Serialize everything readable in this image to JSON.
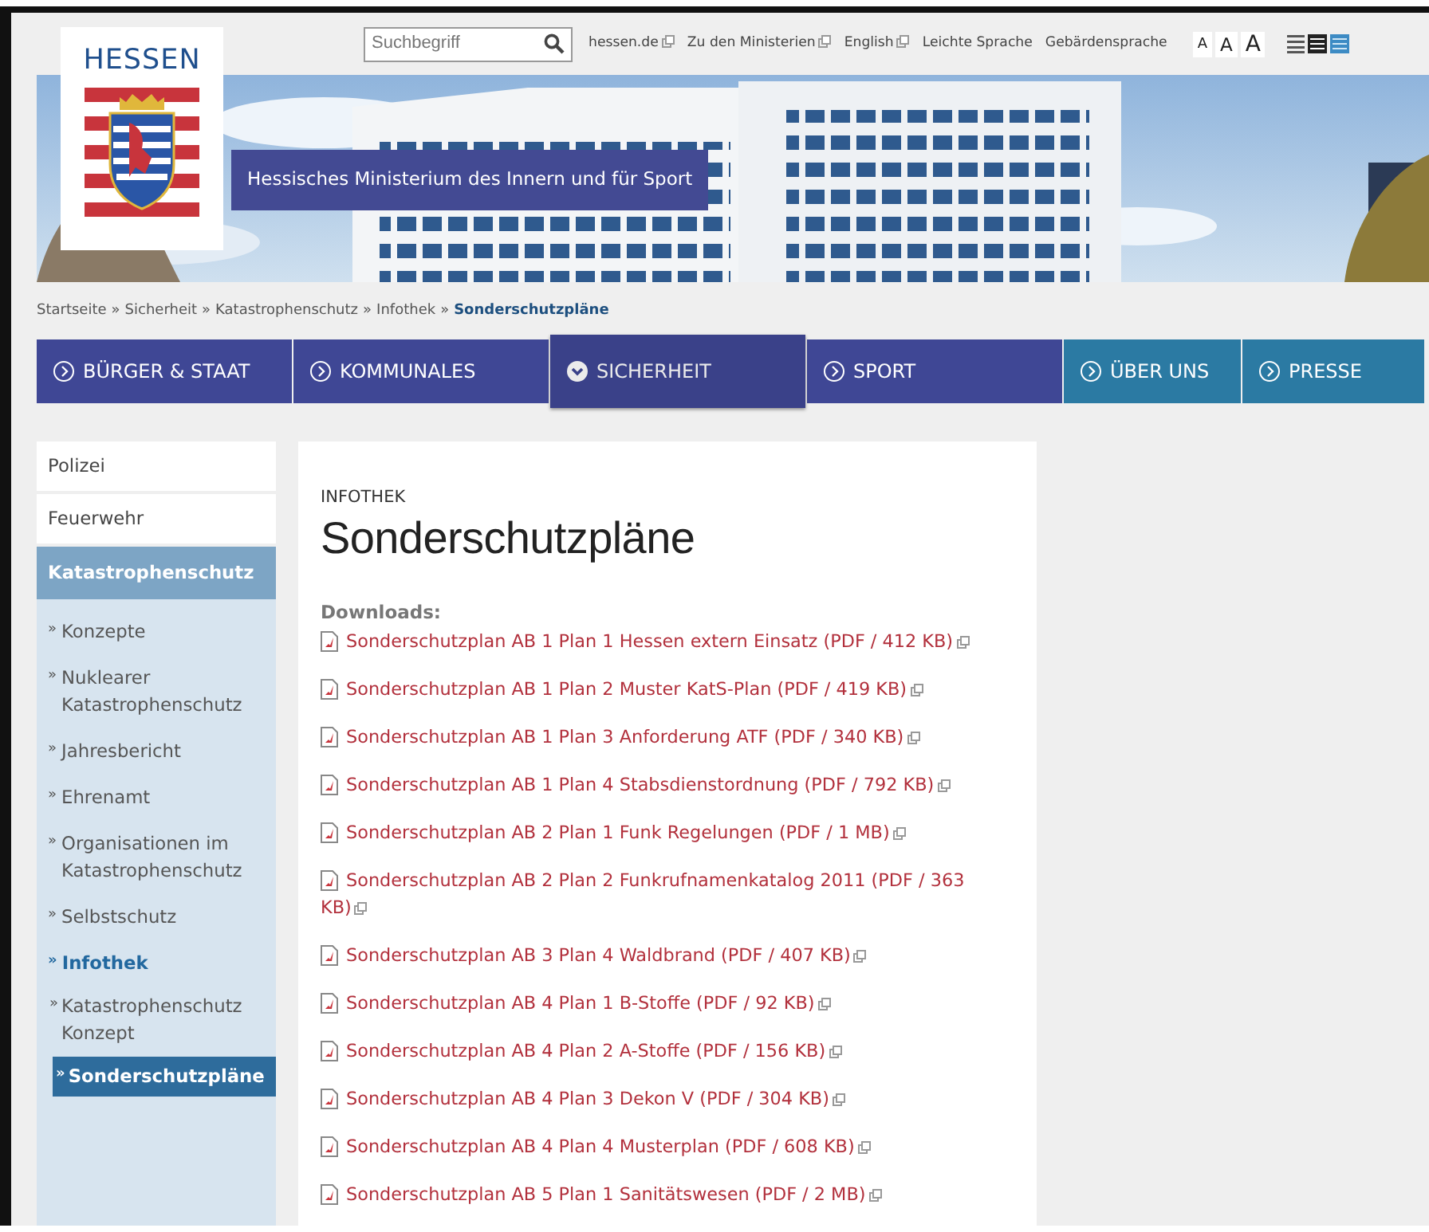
{
  "logo": {
    "text": "HESSEN"
  },
  "search": {
    "placeholder": "Suchbegriff"
  },
  "service_links": [
    {
      "label": "hessen.de",
      "external": true
    },
    {
      "label": "Zu den Ministerien",
      "external": true
    },
    {
      "label": "English",
      "external": true
    },
    {
      "label": "Leichte Sprache",
      "external": false
    },
    {
      "label": "Gebärdensprache",
      "external": false
    }
  ],
  "font_sizes": [
    "A",
    "A",
    "A"
  ],
  "ministry": "Hessisches Ministerium des Innern und für Sport",
  "breadcrumb": {
    "separators": [
      "»",
      "»",
      "»",
      "»"
    ],
    "items": [
      {
        "label": "Startseite",
        "current": false
      },
      {
        "label": "Sicherheit",
        "current": false
      },
      {
        "label": "Katastrophenschutz",
        "current": false
      },
      {
        "label": "Infothek",
        "current": false
      },
      {
        "label": "Sonderschutzpläne",
        "current": true
      }
    ]
  },
  "nav": [
    {
      "label": "BÜRGER & STAAT",
      "selected": false,
      "color": "#3f4795"
    },
    {
      "label": "KOMMUNALES",
      "selected": false,
      "color": "#3f4795"
    },
    {
      "label": "SICHERHEIT",
      "selected": true,
      "color": "#3f4795"
    },
    {
      "label": "SPORT",
      "selected": false,
      "color": "#3f4795"
    },
    {
      "label": "ÜBER UNS",
      "selected": false,
      "color": "#2b7aa3"
    },
    {
      "label": "PRESSE",
      "selected": false,
      "color": "#2b7aa3"
    }
  ],
  "sidebar": [
    {
      "kind": "top",
      "label": "Polizei"
    },
    {
      "kind": "top",
      "label": "Feuerwehr"
    },
    {
      "kind": "section",
      "label": "Katastrophenschutz",
      "children": [
        {
          "bullet": "»",
          "label": "Konzepte",
          "selected": false
        },
        {
          "bullet": "»",
          "label": "Nuklearer Katastrophenschutz",
          "selected": false
        },
        {
          "bullet": "»",
          "label": "Jahresbericht",
          "selected": false
        },
        {
          "bullet": "»",
          "label": "Ehrenamt",
          "selected": false
        },
        {
          "bullet": "»",
          "label": "Organisationen im Katastrophenschutz",
          "selected": false
        },
        {
          "bullet": "»",
          "label": "Selbstschutz",
          "selected": false
        },
        {
          "bullet": "»",
          "label": "Infothek",
          "selected": true,
          "children": [
            {
              "bullet": "»",
              "label": "Katastrophenschutz Konzept",
              "selected": false
            },
            {
              "bullet": "»",
              "label": "Sonderschutzpläne",
              "selected": true
            }
          ]
        }
      ]
    }
  ],
  "content": {
    "kicker": "INFOTHEK",
    "title": "Sonderschutzpläne",
    "downloads_label": "Downloads:",
    "downloads": [
      {
        "label": "Sonderschutzplan AB 1 Plan 1 Hessen extern Einsatz (PDF / 412 KB)"
      },
      {
        "label": "Sonderschutzplan AB 1 Plan 2 Muster KatS-Plan (PDF / 419 KB)"
      },
      {
        "label": "Sonderschutzplan AB 1 Plan 3 Anforderung ATF (PDF / 340 KB)"
      },
      {
        "label": "Sonderschutzplan AB 1 Plan 4 Stabsdienstordnung (PDF / 792 KB)"
      },
      {
        "label": "Sonderschutzplan AB 2 Plan 1 Funk Regelungen (PDF / 1 MB)"
      },
      {
        "label": "Sonderschutzplan AB 2 Plan 2 Funkrufnamenkatalog 2011 (PDF / 363 KB)"
      },
      {
        "label": "Sonderschutzplan AB 3 Plan 4 Waldbrand (PDF / 407 KB)"
      },
      {
        "label": "Sonderschutzplan AB 4 Plan 1 B-Stoffe (PDF / 92 KB)"
      },
      {
        "label": "Sonderschutzplan AB 4 Plan 2 A-Stoffe (PDF / 156 KB)"
      },
      {
        "label": "Sonderschutzplan AB 4 Plan 3 Dekon V (PDF / 304 KB)"
      },
      {
        "label": "Sonderschutzplan AB 4 Plan 4 Musterplan (PDF / 608 KB)"
      },
      {
        "label": "Sonderschutzplan AB 5 Plan 1 Sanitätswesen (PDF / 2 MB)"
      }
    ]
  }
}
